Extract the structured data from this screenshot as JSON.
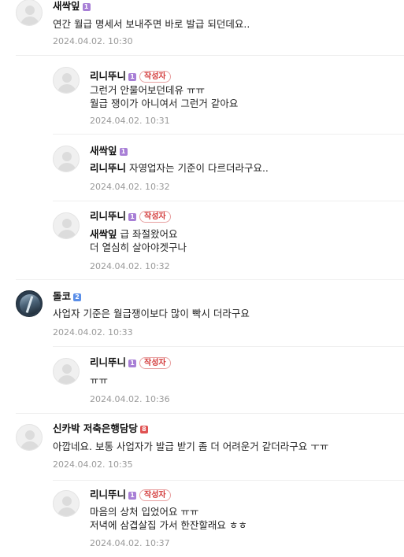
{
  "comments": {
    "c1": {
      "name": "새싹잎",
      "level": "1",
      "text": "연간 월급 명세서 보내주면 바로 발급 되던데요..",
      "date": "2024.04.02. 10:30"
    },
    "r1": {
      "name": "리니뚜니",
      "level": "1",
      "badge": "작성자",
      "line1": "그런거 안물어보던데유 ㅠㅠ",
      "line2": "월급 쟁이가 아니여서 그런거 같아요",
      "date": "2024.04.02. 10:31"
    },
    "r2": {
      "name": "새싹잎",
      "level": "1",
      "mention": "리니뚜니",
      "text": "자영업자는 기준이 다르더라구요..",
      "date": "2024.04.02. 10:32"
    },
    "r3": {
      "name": "리니뚜니",
      "level": "1",
      "badge": "작성자",
      "mention": "새싹잎",
      "line1": "급 좌절왔어요",
      "line2": "더 열심히 살아야겟구나",
      "date": "2024.04.02. 10:32"
    },
    "c2": {
      "name": "돌코",
      "level": "2",
      "text": "사업자 기준은 월급쟁이보다 많이 빡시 더라구요",
      "date": "2024.04.02. 10:33"
    },
    "r4": {
      "name": "리니뚜니",
      "level": "1",
      "badge": "작성자",
      "text": "ㅠㅠ",
      "date": "2024.04.02. 10:36"
    },
    "c3": {
      "name": "신카박 저축은행담당",
      "level": "8",
      "text": "아깝네요. 보통 사업자가 발급 받기 좀 더 어려운거 같더라구요 ㅜㅠ",
      "date": "2024.04.02. 10:35"
    },
    "r5": {
      "name": "리니뚜니",
      "level": "1",
      "badge": "작성자",
      "line1": "마음의 상처 입었어요 ㅠㅠ",
      "line2": "저녁에 삼겹살집 가서 한잔할래요 ㅎㅎ",
      "date": "2024.04.02. 10:37"
    }
  }
}
